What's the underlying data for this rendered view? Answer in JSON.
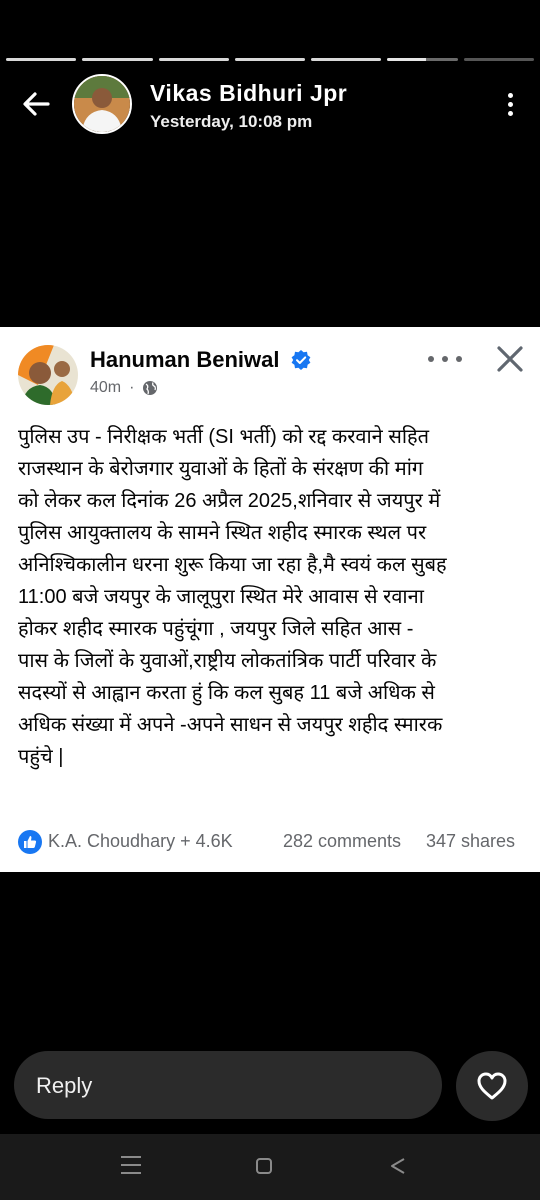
{
  "story": {
    "progress_segments": 7,
    "active_segment": 6,
    "active_segment_progress": 0.55,
    "user_name": "Vikas Bidhuri Jpr",
    "timestamp": "Yesterday, 10:08 pm"
  },
  "post": {
    "author": "Hanuman Beniwal",
    "verified": true,
    "time": "40m",
    "audience_icon": "globe-icon",
    "text": "पुलिस उप - निरीक्षक भर्ती (SI भर्ती) को रद्द करवाने सहित\nराजस्थान के बेरोजगार युवाओं के हितों के संरक्षण की मांग\nको लेकर कल दिनांक 26 अप्रैल 2025,शनिवार से जयपुर में\nपुलिस आयुक्तालय के सामने स्थित शहीद स्मारक स्थल पर\nअनिश्चिकालीन धरना शुरू किया जा रहा है,मै स्वयं कल सुबह\n11:00 बजे जयपुर के जालूपुरा स्थित मेरे आवास से रवाना\nहोकर शहीद स्मारक पहुंचूंगा  , जयपुर जिले सहित आस -\nपास के जिलों के युवाओं,राष्ट्रीय लोकतांत्रिक पार्टी परिवार के\nसदस्यों से आह्वान करता हुं कि कल सुबह 11 बजे अधिक से\nअधिक संख्या में अपने -अपने साधन से जयपुर शहीद स्मारक\nपहुंचे |",
    "reactions": "K.A. Choudhary + 4.6K",
    "comments": "282 comments",
    "shares": "347 shares"
  },
  "reply": {
    "placeholder": "Reply"
  },
  "colors": {
    "facebook_blue": "#1877f2",
    "card_bg": "#ffffff",
    "story_bg": "#000000"
  }
}
